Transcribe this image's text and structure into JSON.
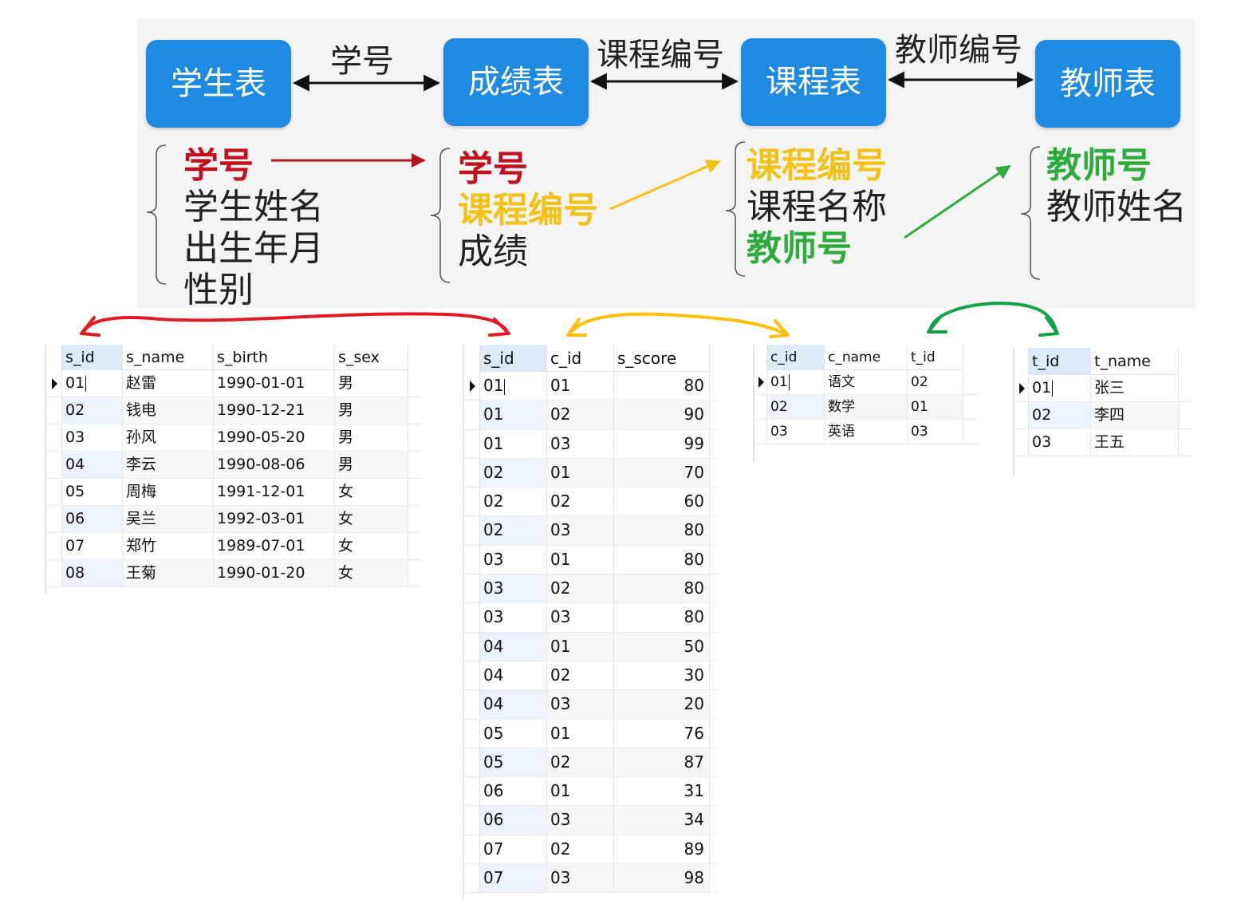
{
  "diagram": {
    "entities": {
      "student": "学生表",
      "score": "成绩表",
      "course": "课程表",
      "teacher": "教师表"
    },
    "relations": {
      "student_score": "学号",
      "score_course": "课程编号",
      "course_teacher": "教师编号"
    },
    "fields": {
      "student": [
        "学号",
        "学生姓名",
        "出生年月",
        "性别"
      ],
      "score": [
        "学号",
        "课程编号",
        "成绩"
      ],
      "course": [
        "课程编号",
        "课程名称",
        "教师号"
      ],
      "teacher": [
        "教师号",
        "教师姓名"
      ]
    },
    "colors": {
      "box": "#1e8ae2",
      "red": "#c0111f",
      "yellow": "#f2c21a",
      "green": "#2eab3c",
      "hand_red": "#e01b22",
      "hand_yellow": "#ffbf10",
      "hand_green": "#13a34a"
    }
  },
  "tables": {
    "student": {
      "columns": [
        "s_id",
        "s_name",
        "s_birth",
        "s_sex"
      ],
      "rows": [
        [
          "01",
          "赵雷",
          "1990-01-01",
          "男"
        ],
        [
          "02",
          "钱电",
          "1990-12-21",
          "男"
        ],
        [
          "03",
          "孙风",
          "1990-05-20",
          "男"
        ],
        [
          "04",
          "李云",
          "1990-08-06",
          "男"
        ],
        [
          "05",
          "周梅",
          "1991-12-01",
          "女"
        ],
        [
          "06",
          "吴兰",
          "1992-03-01",
          "女"
        ],
        [
          "07",
          "郑竹",
          "1989-07-01",
          "女"
        ],
        [
          "08",
          "王菊",
          "1990-01-20",
          "女"
        ]
      ]
    },
    "score": {
      "columns": [
        "s_id",
        "c_id",
        "s_score"
      ],
      "rows": [
        [
          "01",
          "01",
          "80"
        ],
        [
          "01",
          "02",
          "90"
        ],
        [
          "01",
          "03",
          "99"
        ],
        [
          "02",
          "01",
          "70"
        ],
        [
          "02",
          "02",
          "60"
        ],
        [
          "02",
          "03",
          "80"
        ],
        [
          "03",
          "01",
          "80"
        ],
        [
          "03",
          "02",
          "80"
        ],
        [
          "03",
          "03",
          "80"
        ],
        [
          "04",
          "01",
          "50"
        ],
        [
          "04",
          "02",
          "30"
        ],
        [
          "04",
          "03",
          "20"
        ],
        [
          "05",
          "01",
          "76"
        ],
        [
          "05",
          "02",
          "87"
        ],
        [
          "06",
          "01",
          "31"
        ],
        [
          "06",
          "03",
          "34"
        ],
        [
          "07",
          "02",
          "89"
        ],
        [
          "07",
          "03",
          "98"
        ]
      ]
    },
    "course": {
      "columns": [
        "c_id",
        "c_name",
        "t_id"
      ],
      "rows": [
        [
          "01",
          "语文",
          "02"
        ],
        [
          "02",
          "数学",
          "01"
        ],
        [
          "03",
          "英语",
          "03"
        ]
      ]
    },
    "teacher": {
      "columns": [
        "t_id",
        "t_name"
      ],
      "rows": [
        [
          "01",
          "张三"
        ],
        [
          "02",
          "李四"
        ],
        [
          "03",
          "王五"
        ]
      ]
    }
  }
}
